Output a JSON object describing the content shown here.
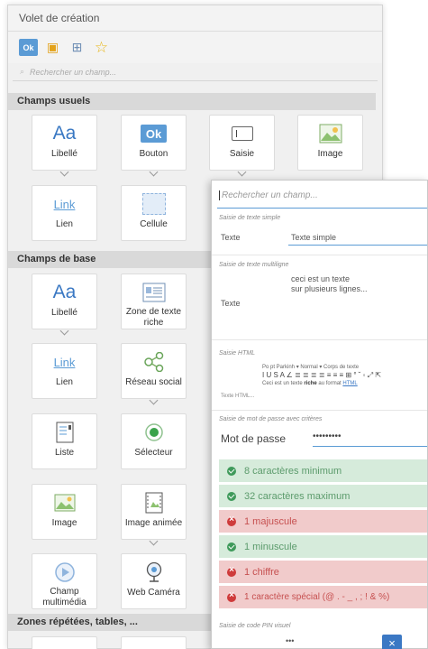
{
  "panel": {
    "title": "Volet de création",
    "mode_icons": [
      "ok-icon",
      "book-icon",
      "grid-icon",
      "star-icon"
    ],
    "mode_ok_label": "Ok",
    "search_placeholder": "Rechercher un champ..."
  },
  "sections": {
    "usuels": "Champs usuels",
    "base": "Champs de base",
    "zones": "Zones répétées, tables, ..."
  },
  "usuels_cards": [
    {
      "label": "Libellé",
      "icon": "text-aa-icon",
      "glyph": "Aa"
    },
    {
      "label": "Bouton",
      "icon": "button-ok-icon",
      "glyph": "Ok"
    },
    {
      "label": "Saisie",
      "icon": "input-field-icon"
    },
    {
      "label": "Image",
      "icon": "image-icon"
    },
    {
      "label": "Lien",
      "icon": "link-icon",
      "glyph": "Link"
    },
    {
      "label": "Cellule",
      "icon": "cell-icon"
    }
  ],
  "base_cards": [
    {
      "label": "Libellé",
      "icon": "text-aa-icon",
      "glyph": "Aa"
    },
    {
      "label": "Zone de texte riche",
      "icon": "rich-text-icon"
    },
    {
      "label": "Lien",
      "icon": "link-icon",
      "glyph": "Link"
    },
    {
      "label": "Réseau social",
      "icon": "social-network-icon"
    },
    {
      "label": "Liste",
      "icon": "list-icon"
    },
    {
      "label": "Sélecteur",
      "icon": "radio-selector-icon"
    },
    {
      "label": "Image",
      "icon": "image-icon"
    },
    {
      "label": "Image animée",
      "icon": "animated-image-icon"
    },
    {
      "label": "Champ multimédia",
      "icon": "multimedia-icon"
    },
    {
      "label": "Web Caméra",
      "icon": "webcam-icon"
    }
  ],
  "overlay": {
    "search_placeholder": "Rechercher un champ...",
    "simple_caption": "Saisie de texte simple",
    "simple_label": "Texte",
    "simple_value": "Texte simple",
    "multi_caption": "Saisie de texte multiligne",
    "multi_label": "Texte",
    "multi_value_1": "ceci est un texte",
    "multi_value_2": "sur plusieurs lignes...",
    "html_caption": "Saisie HTML",
    "html_toolbar_1": "Po  pt  Parkinh   ▾  Normal   ▾  Corps de texte",
    "html_toolbar_2": "I U S A ∠ ≣ ≣ ≣ ≣ ≡ ≡ ≡ ⊞ ° ˘ ◦ ⤢ ⇱",
    "html_text_prefix": "Ceci est un texte ",
    "html_text_bold": "riche",
    "html_text_mid": " au format ",
    "html_text_link": "HTML",
    "html_label": "Texte HTML...",
    "pwd_caption": "Saisie de mot de passe avec critères",
    "pwd_label": "Mot de passe",
    "pwd_value": "•••••••••",
    "rules": [
      {
        "text": "8 caractères minimum",
        "ok": true
      },
      {
        "text": "32 caractères maximum",
        "ok": true
      },
      {
        "text": "1 majuscule",
        "ok": false
      },
      {
        "text": "1 minuscule",
        "ok": true
      },
      {
        "text": "1 chiffre",
        "ok": false
      },
      {
        "text": "1 caractère spécial (@ . - _ , ; ! & %)",
        "ok": false
      }
    ],
    "pin_caption": "Saisie de code PIN visuel",
    "pin_value": "•••",
    "close_glyph": "×"
  },
  "colors": {
    "accent": "#5b9bd5",
    "ok_bg": "#d6ebdb",
    "ko_bg": "#f1cbcb",
    "section_bg": "#d9d9d9"
  }
}
